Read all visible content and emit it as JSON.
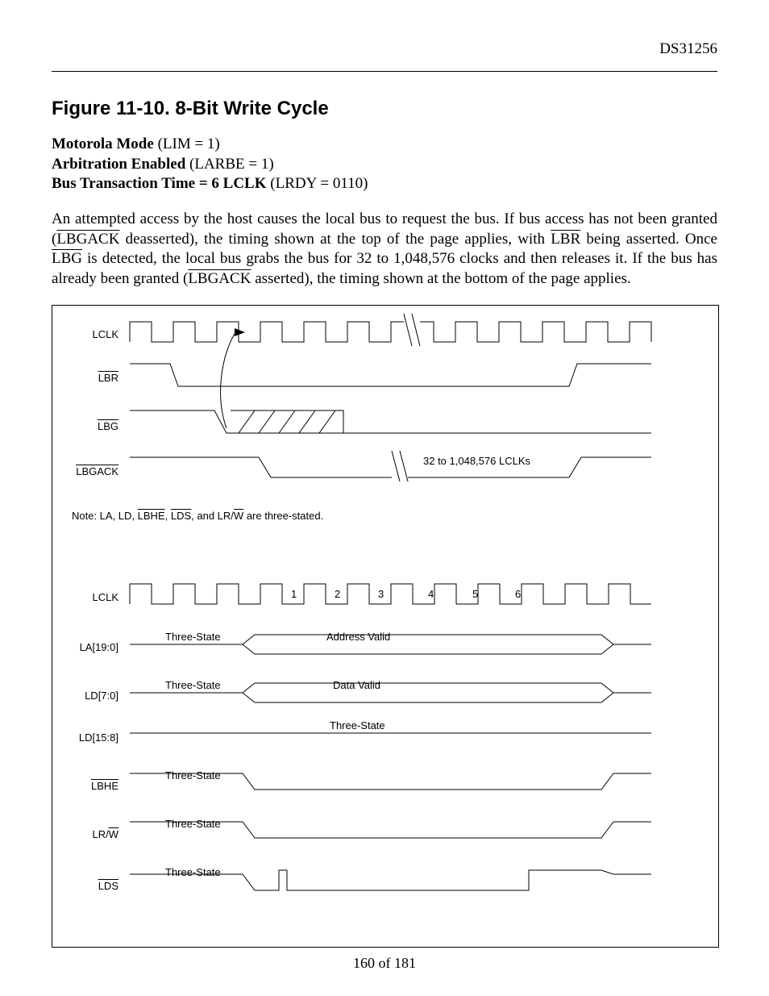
{
  "header": {
    "doc_id": "DS31256"
  },
  "figure": {
    "title": "Figure 11-10. 8-Bit Write Cycle"
  },
  "modes": {
    "line1_b": "Motorola Mode",
    "line1_r": " (LIM = 1)",
    "line2_b": "Arbitration Enabled",
    "line2_r": " (LARBE = 1)",
    "line3_b": "Bus Transaction Time = 6 LCLK",
    "line3_r": " (LRDY = 0110)"
  },
  "body": {
    "p1a": "An attempted access by the host causes the local bus to request the bus. If bus access has not been granted (",
    "p1b": " deasserted), the timing shown at the top of the page applies, with ",
    "p1c": " being asserted. Once ",
    "p1d": " is detected, the local bus grabs the bus for 32 to 1,048,576 clocks and then releases it. If the bus has already been granted (",
    "p1e": " asserted), the timing shown at the bottom of the page applies.",
    "ov_lbgack": "LBGACK",
    "ov_lbr": "LBR",
    "ov_lbg": "LBG"
  },
  "diagram": {
    "signals_top": {
      "lclk": "LCLK",
      "lbr": "LBR",
      "lbg": "LBG",
      "lbgack": "LBGACK"
    },
    "note": {
      "prefix": "Note: LA, LD, ",
      "ov1": "LBHE",
      "mid1": ", ",
      "ov2": "LDS",
      "mid2": ", and LR/",
      "ov3": "W",
      "suffix": " are three-stated."
    },
    "annotation_clocks": "32 to 1,048,576 LCLKs",
    "signals_bottom": {
      "lclk": "LCLK",
      "la": "LA[19:0]",
      "ld7": "LD[7:0]",
      "ld15": "LD[15:8]",
      "lbhe": "LBHE",
      "lrw_pre": "LR/",
      "lrw_ov": "W",
      "lds": "LDS"
    },
    "labels": {
      "three_state": "Three-State",
      "addr_valid": "Address Valid",
      "data_valid": "Data Valid",
      "cycle_nums": [
        "1",
        "2",
        "3",
        "4",
        "5",
        "6"
      ]
    }
  },
  "footer": {
    "page": "160 of 181"
  }
}
